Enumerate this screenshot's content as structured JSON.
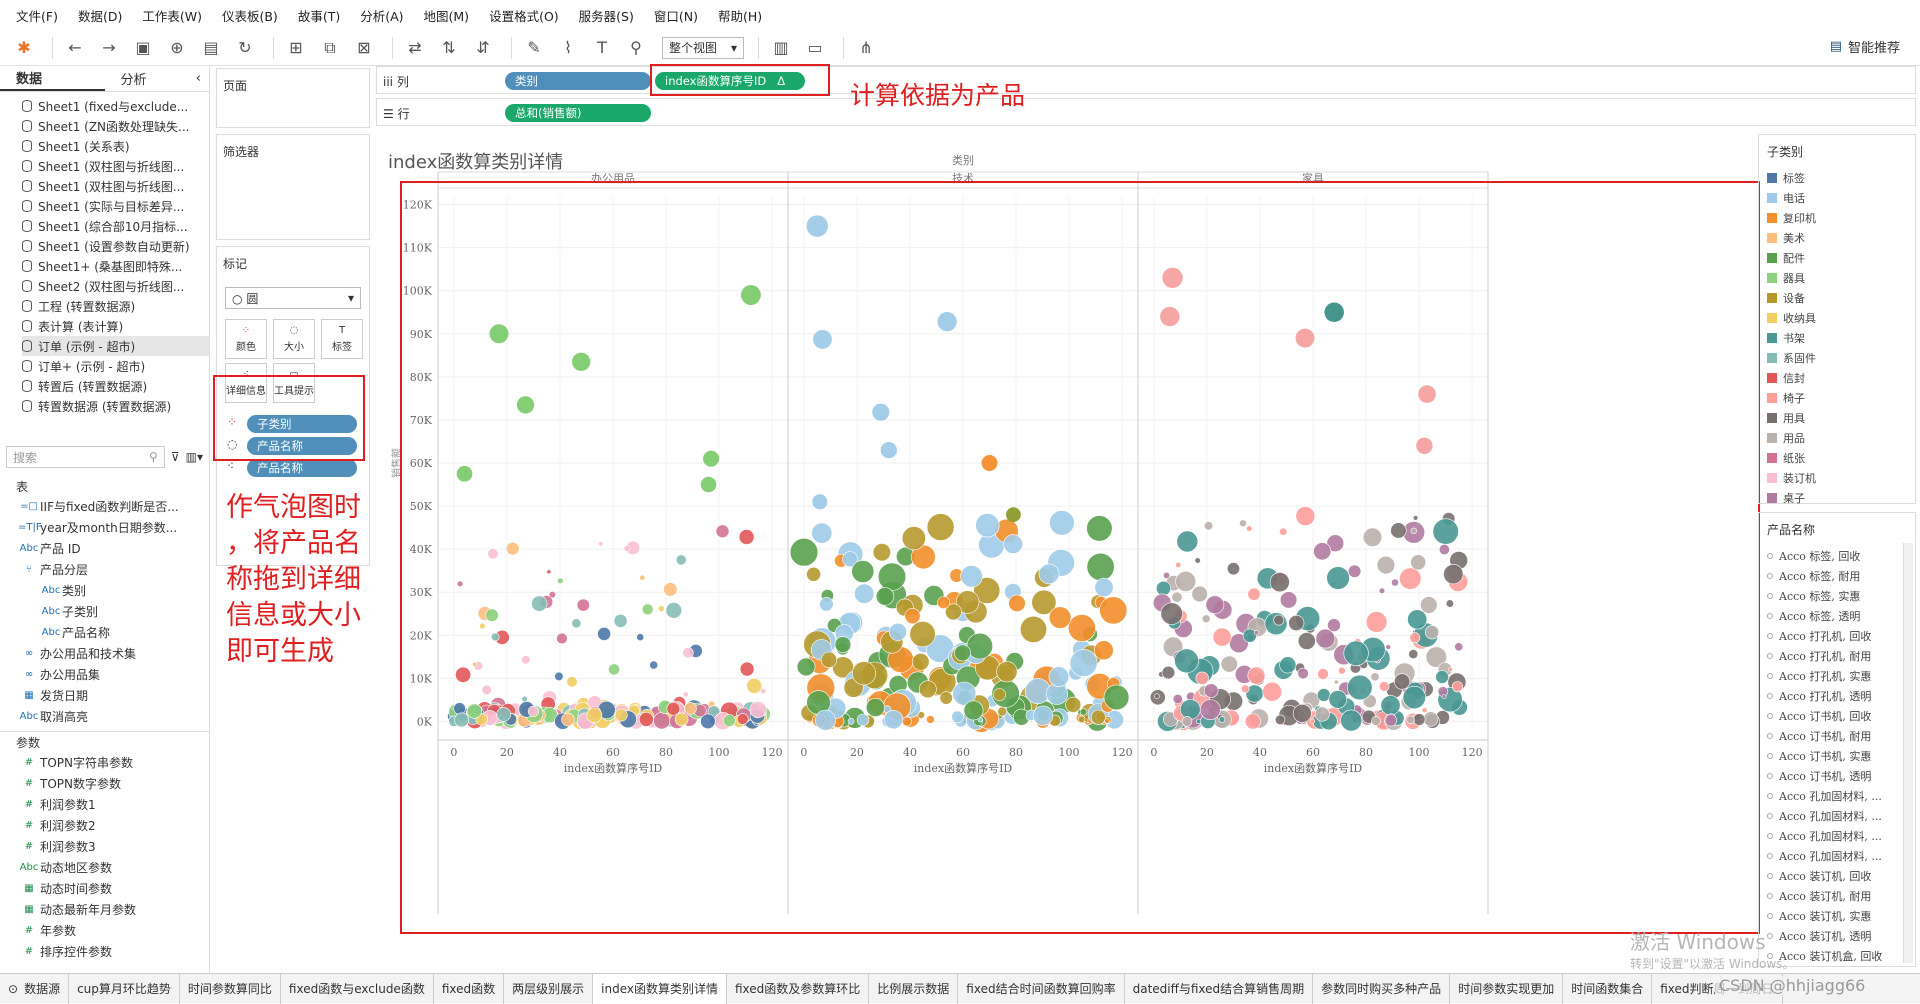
{
  "menu": [
    "文件(F)",
    "数据(D)",
    "工作表(W)",
    "仪表板(B)",
    "故事(T)",
    "分析(A)",
    "地图(M)",
    "设置格式(O)",
    "服务器(S)",
    "窗口(N)",
    "帮助(H)"
  ],
  "toolbar": {
    "view_select": "整个视图",
    "smart": "智能推荐"
  },
  "left": {
    "tab_data": "数据",
    "tab_analysis": "分析",
    "datasources": [
      "Sheet1 (fixed与exclude...",
      "Sheet1 (ZN函数处理缺失...",
      "Sheet1 (关系表)",
      "Sheet1 (双柱图与折线图...",
      "Sheet1 (双柱图与折线图...",
      "Sheet1 (实际与目标差异...",
      "Sheet1 (综合部10月指标...",
      "Sheet1 (设置参数自动更新)",
      "Sheet1+ (桑基图即特殊...",
      "Sheet2 (双柱图与折线图...",
      "工程 (转置数据源)",
      "表计算 (表计算)",
      "订单 (示例 - 超市)",
      "订单+ (示例 - 超市)",
      "转置后 (转置数据源)",
      "转置数据源 (转置数据源)"
    ],
    "search_placeholder": "搜索",
    "section_table": "表",
    "fields": [
      {
        "icon": "=□",
        "name": "IIF与fixed函数判断是否..."
      },
      {
        "icon": "=T|F",
        "name": "year及month日期参数..."
      },
      {
        "icon": "Abc",
        "name": "产品 ID"
      },
      {
        "icon": "⑂",
        "name": "产品分层"
      },
      {
        "icon": "Abc",
        "name": "类别"
      },
      {
        "icon": "Abc",
        "name": "子类别"
      },
      {
        "icon": "Abc",
        "name": "产品名称"
      },
      {
        "icon": "∞",
        "name": "办公用品和技术集"
      },
      {
        "icon": "∞",
        "name": "办公用品集"
      },
      {
        "icon": "▦",
        "name": "发货日期"
      },
      {
        "icon": "Abc",
        "name": "取消高亮"
      }
    ],
    "section_params": "参数",
    "params": [
      "TOPN字符串参数",
      "TOPN数字参数",
      "利润参数1",
      "利润参数2",
      "利润参数3",
      "动态地区参数",
      "动态时间参数",
      "动态最新年月参数",
      "年参数",
      "排序控件参数"
    ],
    "param_icons": [
      "#",
      "#",
      "#",
      "#",
      "#",
      "Abc",
      "▦",
      "▦",
      "#",
      "#"
    ]
  },
  "cards": {
    "pages": "页面",
    "filters": "筛选器",
    "marks": "标记",
    "mark_type": "圆",
    "buttons": [
      "颜色",
      "大小",
      "标签",
      "详细信息",
      "工具提示"
    ],
    "pills": [
      "子类别",
      "产品名称",
      "产品名称"
    ]
  },
  "shelves": {
    "col_label": "列",
    "row_label": "行",
    "col_pill_1": "类别",
    "col_pill_2": "index函数算序号ID",
    "row_pill": "总和(销售额)"
  },
  "sheet_title": "index函数算类别详情",
  "chart_data": {
    "type": "scatter",
    "title": "index函数算类别详情",
    "header": "类别",
    "panels": [
      "办公用品",
      "技术",
      "家具"
    ],
    "xlabel": "index函数算序号ID",
    "ylabel": "销售额",
    "xlim": [
      -6,
      126
    ],
    "ylim": [
      -2000,
      122000
    ],
    "xticks": [
      0,
      20,
      40,
      60,
      80,
      100,
      120
    ],
    "yticks": [
      "0K",
      "10K",
      "20K",
      "30K",
      "40K",
      "50K",
      "60K",
      "70K",
      "80K",
      "90K",
      "100K",
      "110K",
      "120K"
    ],
    "labeled_points": [
      {
        "panel": 0,
        "x": 112,
        "y": 99000,
        "color": "#7dcb6e"
      },
      {
        "panel": 0,
        "x": 17,
        "y": 90000,
        "color": "#7dcb6e"
      },
      {
        "panel": 0,
        "x": 48,
        "y": 83500,
        "color": "#7dcb6e"
      },
      {
        "panel": 0,
        "x": 27,
        "y": 73500,
        "color": "#7dcb6e"
      },
      {
        "panel": 0,
        "x": 97,
        "y": 61000,
        "color": "#7dcb6e"
      },
      {
        "panel": 0,
        "x": 96,
        "y": 55000,
        "color": "#7dcb6e"
      },
      {
        "panel": 0,
        "x": 4,
        "y": 57500,
        "color": "#7dcb6e"
      },
      {
        "panel": 1,
        "x": 5,
        "y": 115000,
        "color": "#9fcae8"
      },
      {
        "panel": 1,
        "x": 7,
        "y": 88700,
        "color": "#9fcae8"
      },
      {
        "panel": 1,
        "x": 54,
        "y": 92800,
        "color": "#9fcae8"
      },
      {
        "panel": 1,
        "x": 29,
        "y": 71800,
        "color": "#9fcae8"
      },
      {
        "panel": 1,
        "x": 32,
        "y": 63000,
        "color": "#9fcae8"
      },
      {
        "panel": 1,
        "x": 6,
        "y": 51000,
        "color": "#9fcae8"
      },
      {
        "panel": 1,
        "x": 70,
        "y": 60000,
        "color": "#f28e2b"
      },
      {
        "panel": 1,
        "x": 79,
        "y": 48000,
        "color": "#8c9a2c"
      },
      {
        "panel": 2,
        "x": 7,
        "y": 103000,
        "color": "#f7a1a1"
      },
      {
        "panel": 2,
        "x": 6,
        "y": 94000,
        "color": "#f7a1a1"
      },
      {
        "panel": 2,
        "x": 68,
        "y": 95000,
        "color": "#3b8f87"
      },
      {
        "panel": 2,
        "x": 57,
        "y": 89000,
        "color": "#f7a1a1"
      },
      {
        "panel": 2,
        "x": 103,
        "y": 76000,
        "color": "#f7a1a1"
      },
      {
        "panel": 2,
        "x": 102,
        "y": 64000,
        "color": "#f7a1a1"
      }
    ]
  },
  "legend": {
    "title": "子类别",
    "items": [
      {
        "name": "标签",
        "color": "#4e79a7"
      },
      {
        "name": "电话",
        "color": "#a0cbe8"
      },
      {
        "name": "复印机",
        "color": "#f28e2b"
      },
      {
        "name": "美术",
        "color": "#ffbe7d"
      },
      {
        "name": "配件",
        "color": "#59a14f"
      },
      {
        "name": "器具",
        "color": "#8cd17d"
      },
      {
        "name": "设备",
        "color": "#b6992d"
      },
      {
        "name": "收纳具",
        "color": "#f1ce63"
      },
      {
        "name": "书架",
        "color": "#499894"
      },
      {
        "name": "系固件",
        "color": "#86bcb6"
      },
      {
        "name": "信封",
        "color": "#e15759"
      },
      {
        "name": "椅子",
        "color": "#ff9d9a"
      },
      {
        "name": "用具",
        "color": "#79706e"
      },
      {
        "name": "用品",
        "color": "#bab0ac"
      },
      {
        "name": "纸张",
        "color": "#d37295"
      },
      {
        "name": "装订机",
        "color": "#fabfd2"
      },
      {
        "name": "桌子",
        "color": "#b07aa1"
      }
    ]
  },
  "product_list": {
    "title": "产品名称",
    "items": [
      "Acco 标签, 回收",
      "Acco 标签, 耐用",
      "Acco 标签, 实惠",
      "Acco 标签, 透明",
      "Acco 打孔机, 回收",
      "Acco 打孔机, 耐用",
      "Acco 打孔机, 实惠",
      "Acco 打孔机, 透明",
      "Acco 订书机, 回收",
      "Acco 订书机, 耐用",
      "Acco 订书机, 实惠",
      "Acco 订书机, 透明",
      "Acco 孔加固材料, ...",
      "Acco 孔加固材料, ...",
      "Acco 孔加固材料, ...",
      "Acco 孔加固材料, ...",
      "Acco 装订机, 回收",
      "Acco 装订机, 耐用",
      "Acco 装订机, 实惠",
      "Acco 装订机, 透明",
      "Acco 装订机盒, 回收"
    ]
  },
  "bottom_tabs": [
    "数据源",
    "cup算月环比趋势",
    "时间参数算同比",
    "fixed函数与exclude函数",
    "fixed函数",
    "两层级别展示",
    "index函数算类别详情",
    "fixed函数及参数算环比",
    "比例展示数据",
    "fixed结合时间函数算回购率",
    "datediff与fixed结合算销售周期",
    "参数同时购买多种产品",
    "时间参数实现更加",
    "时间函数集合",
    "fixed判断周一到周日"
  ],
  "annotations": {
    "calc_note": "计算依据为产品",
    "bubble_note_lines": [
      "作气泡图时",
      "，将产品名",
      "称拖到详细",
      "信息或大小",
      "即可生成"
    ]
  },
  "watermark": {
    "line1": "激活 Windows",
    "line2": "转到\"设置\"以激活 Windows。",
    "csdn": "CSDN @hhjiagg66"
  }
}
